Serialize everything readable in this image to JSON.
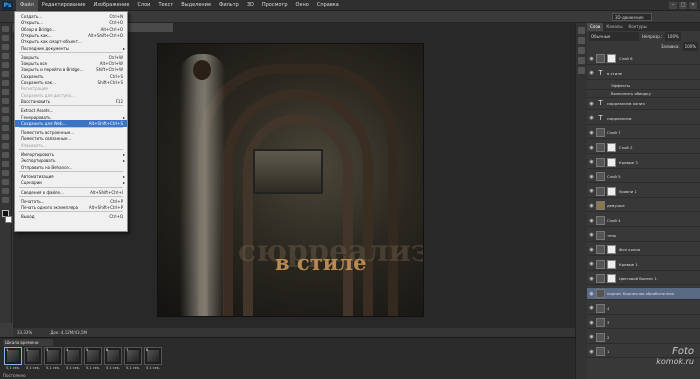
{
  "app": {
    "logo": "Ps"
  },
  "menubar": [
    "Файл",
    "Редактирование",
    "Изображение",
    "Слои",
    "Текст",
    "Выделение",
    "Фильтр",
    "3D",
    "Просмотр",
    "Окно",
    "Справка"
  ],
  "workspace": "3D-движение",
  "document": {
    "tab": "",
    "canvas_text": "в стиле",
    "canvas_shadow_text": "сюрреализм"
  },
  "status": {
    "zoom": "33,33%",
    "doc": "Док: 4,12M/43,5M"
  },
  "file_menu": [
    {
      "label": "Создать...",
      "key": "Ctrl+N"
    },
    {
      "label": "Открыть...",
      "key": "Ctrl+O"
    },
    {
      "label": "Обзор в Bridge...",
      "key": "Alt+Ctrl+O"
    },
    {
      "label": "Открыть как...",
      "key": "Alt+Shift+Ctrl+O"
    },
    {
      "label": "Открыть как смарт-объект..."
    },
    {
      "label": "Последние документы",
      "submenu": true
    },
    {
      "sep": true
    },
    {
      "label": "Закрыть",
      "key": "Ctrl+W"
    },
    {
      "label": "Закрыть все",
      "key": "Alt+Ctrl+W"
    },
    {
      "label": "Закрыть и перейти в Bridge...",
      "key": "Shift+Ctrl+W"
    },
    {
      "label": "Сохранить",
      "key": "Ctrl+S"
    },
    {
      "label": "Сохранить как...",
      "key": "Shift+Ctrl+S"
    },
    {
      "label": "Регистрация",
      "disabled": true
    },
    {
      "label": "Сохранить для доступа...",
      "disabled": true
    },
    {
      "label": "Восстановить",
      "key": "F12"
    },
    {
      "sep": true
    },
    {
      "label": "Extract Assets..."
    },
    {
      "label": "Генерировать",
      "submenu": true
    },
    {
      "label": "Сохранить для Web...",
      "key": "Alt+Shift+Ctrl+S",
      "highlight": true
    },
    {
      "sep": true
    },
    {
      "label": "Поместить встроенные..."
    },
    {
      "label": "Поместить связанные..."
    },
    {
      "label": "Упаковать...",
      "disabled": true
    },
    {
      "sep": true
    },
    {
      "label": "Импортировать",
      "submenu": true
    },
    {
      "label": "Экспортировать",
      "submenu": true
    },
    {
      "label": "Отправить на Behance..."
    },
    {
      "sep": true
    },
    {
      "label": "Автоматизация",
      "submenu": true
    },
    {
      "label": "Сценарии",
      "submenu": true
    },
    {
      "sep": true
    },
    {
      "label": "Сведения о файле...",
      "key": "Alt+Shift+Ctrl+I"
    },
    {
      "sep": true
    },
    {
      "label": "Печатать...",
      "key": "Ctrl+P"
    },
    {
      "label": "Печать одного экземпляра",
      "key": "Alt+Shift+Ctrl+P"
    },
    {
      "sep": true
    },
    {
      "label": "Выход",
      "key": "Ctrl+Q"
    }
  ],
  "right_panel": {
    "tabs": [
      "Слои",
      "Каналы",
      "Контуры"
    ],
    "blend_mode": "Обычные",
    "opacity": "100%",
    "fill": "100%",
    "layers": [
      {
        "name": "Слой 6",
        "mask": true
      },
      {
        "name": "в стиле",
        "type": "text"
      },
      {
        "name": "Эффекты",
        "sub": true
      },
      {
        "name": "Выполнить обводку",
        "sub": true
      },
      {
        "name": "сюрреализм  копия",
        "type": "text"
      },
      {
        "name": "сюрреализм",
        "type": "text"
      },
      {
        "name": "Слой 7"
      },
      {
        "name": "Слой 2",
        "mask": true
      },
      {
        "name": "Кривые 3",
        "mask": true
      },
      {
        "name": "Слой 5"
      },
      {
        "name": "Уровни 1",
        "mask": true
      },
      {
        "name": "девушка",
        "type": "group"
      },
      {
        "name": "Слой 4"
      },
      {
        "name": "тень"
      },
      {
        "name": "Фон копия",
        "mask": true
      },
      {
        "name": "Кривые 1",
        "mask": true
      },
      {
        "name": "Цветовой баланс 1",
        "mask": true
      },
      {
        "name": "кирпич Кирпичная обработанная",
        "selected": true
      },
      {
        "name": "4"
      },
      {
        "name": "3"
      },
      {
        "name": "2"
      },
      {
        "name": "1"
      }
    ]
  },
  "timeline": {
    "tab": "Шкала времени",
    "frames": [
      {
        "n": "1",
        "dur": "0,1 сек."
      },
      {
        "n": "2",
        "dur": "0,1 сек."
      },
      {
        "n": "3",
        "dur": "0,1 сек."
      },
      {
        "n": "4",
        "dur": "0,1 сек."
      },
      {
        "n": "5",
        "dur": "0,1 сек."
      },
      {
        "n": "6",
        "dur": "0,1 сек."
      },
      {
        "n": "7",
        "dur": "0,1 сек."
      },
      {
        "n": "8",
        "dur": "0,1 сек."
      }
    ],
    "loop": "Постоянно"
  },
  "watermark": {
    "line1": "Foto",
    "line2": "komok.ru"
  }
}
